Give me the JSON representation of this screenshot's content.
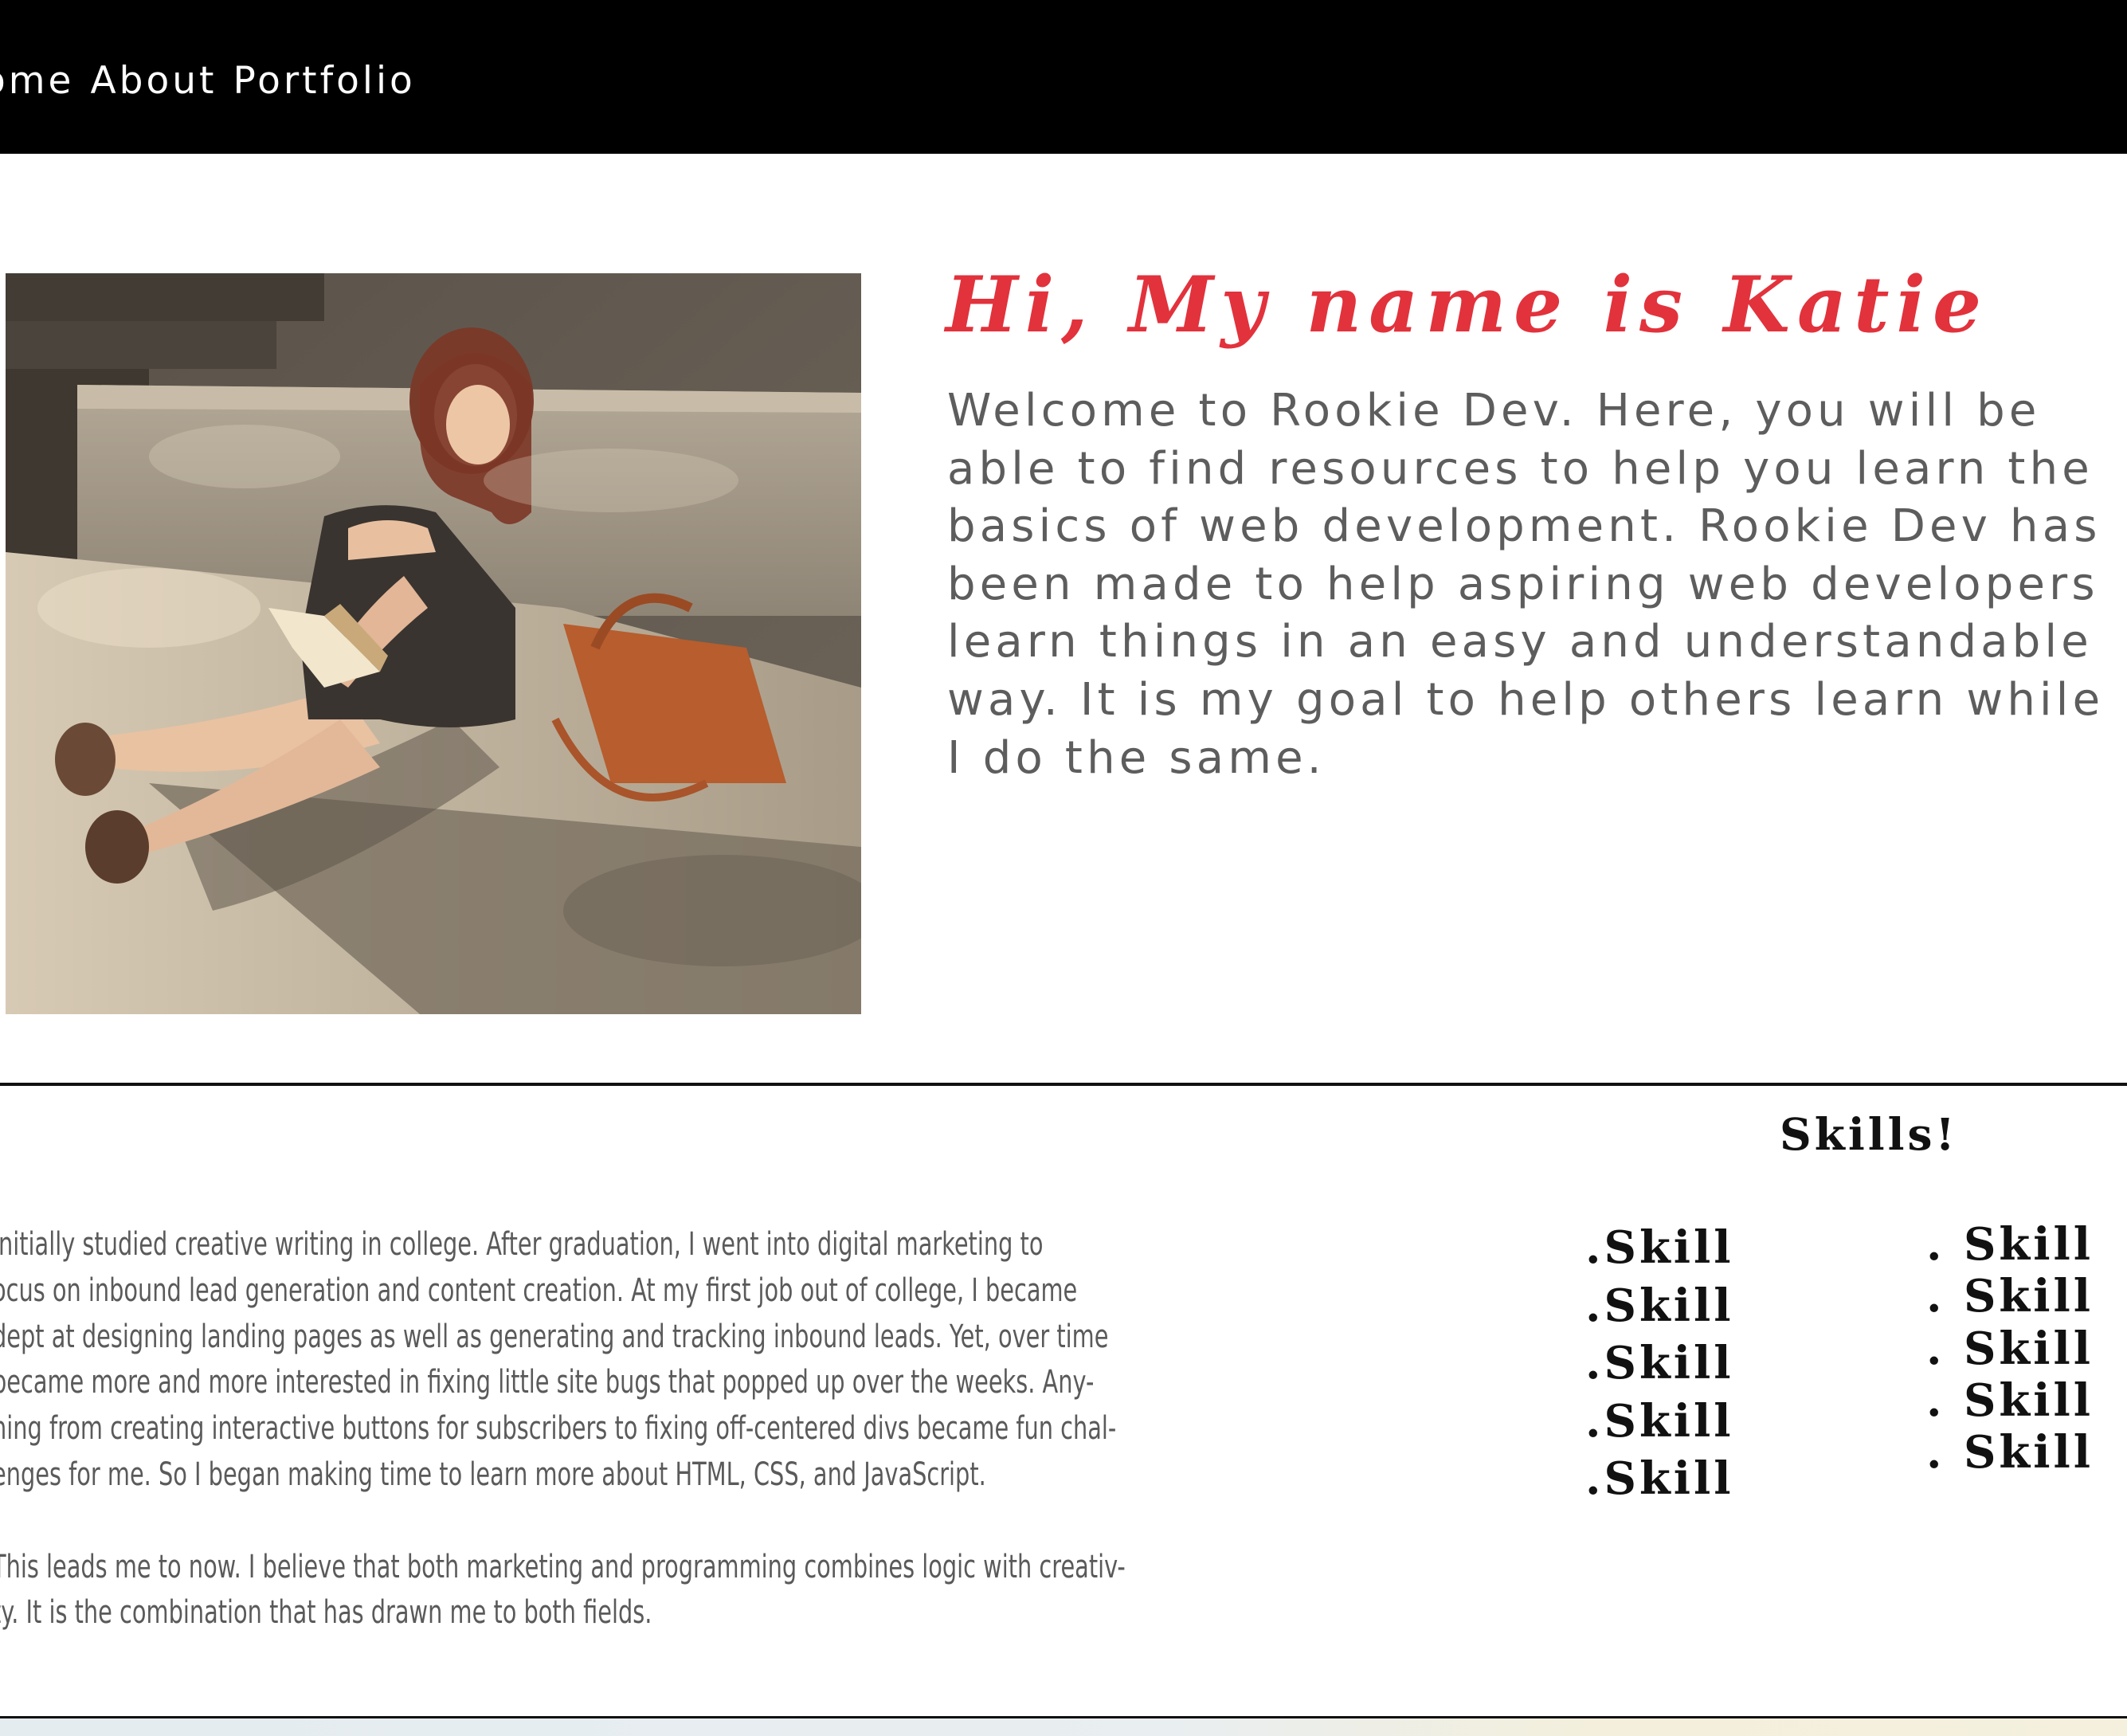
{
  "nav": {
    "links": [
      "ome",
      "About",
      "Portfolio"
    ],
    "background": "#000000",
    "text_color": "#ffffff"
  },
  "hero": {
    "photo_icon": "portrait-photo",
    "title": "Hi, My name is Katie",
    "title_color": "#e2323c",
    "intro_lines": [
      "Welcome to Rookie Dev. Here, you will be",
      "able to find resources to help you learn the",
      "basics of web development. Rookie Dev has",
      "been made to help aspiring web developers",
      "learn things in an easy and understandable",
      "way. It is my goal to help others learn while",
      "I do the same."
    ],
    "text_color": "#5d5d5d"
  },
  "about": {
    "paragraph_1": [
      " initially studied creative writing in college. After graduation, I went into digital marketing to",
      "ocus on inbound lead generation and content creation. At my first job out of college, I became",
      "dept at designing landing pages as well as generating and tracking inbound leads. Yet, over time",
      " became more and more interested in fixing little site bugs that popped up over the weeks. Any-",
      "hing from creating interactive buttons for subscribers to fixing off-centered divs became fun chal-",
      "enges for me. So I began making time to learn more about HTML, CSS, and JavaScript."
    ],
    "paragraph_2": [
      "This leads me to now. I believe that both marketing and programming combines logic with creativ-",
      "ty. It is the combination that has drawn me to both fields."
    ]
  },
  "skills": {
    "title": "Skills!",
    "column_1": [
      ".Skill",
      ".Skill",
      ".Skill",
      ".Skill",
      ".Skill"
    ],
    "column_2": [
      ". Skill",
      ". Skill",
      ". Skill",
      ". Skill",
      ". Skill"
    ]
  }
}
